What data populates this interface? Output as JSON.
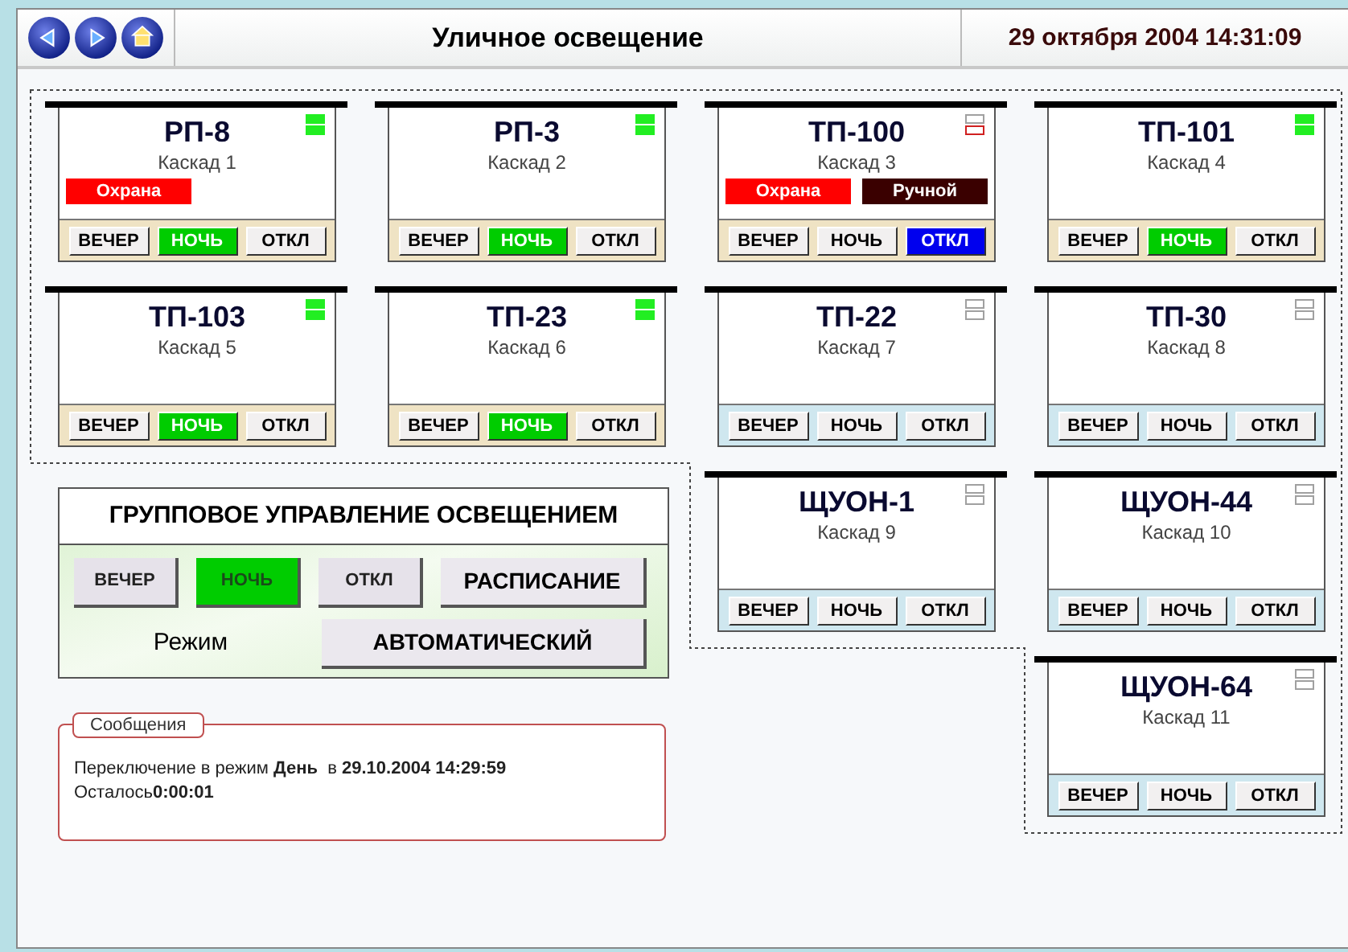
{
  "header": {
    "nav": [
      {
        "kind": "back"
      },
      {
        "kind": "forward"
      },
      {
        "kind": "home"
      }
    ],
    "title": "Уличное освещение",
    "datetime": "29 октября 2004 14:31:09"
  },
  "cards": [
    {
      "name": "РП-8",
      "subtitle": "Каскад 1",
      "lit": true,
      "fault": false,
      "connected": true,
      "tags": [
        {
          "text": "Охрана",
          "kind": "guard"
        }
      ],
      "buttons": [
        {
          "label": "ВЕЧЕР",
          "selected": false
        },
        {
          "label": "НОЧЬ",
          "selected": true
        },
        {
          "label": "ОТКЛ",
          "selected": false
        }
      ]
    },
    {
      "name": "РП-3",
      "subtitle": "Каскад 2",
      "lit": true,
      "fault": false,
      "connected": true,
      "buttons": [
        {
          "label": "ВЕЧЕР",
          "selected": false
        },
        {
          "label": "НОЧЬ",
          "selected": true
        },
        {
          "label": "ОТКЛ",
          "selected": false
        }
      ]
    },
    {
      "name": "ТП-100",
      "subtitle": "Каскад 3",
      "lit": false,
      "fault": true,
      "connected": true,
      "tags": [
        {
          "text": "Охрана",
          "kind": "guard"
        },
        {
          "text": "Ручной",
          "kind": "manual"
        }
      ],
      "buttons": [
        {
          "label": "ВЕЧЕР",
          "selected": false
        },
        {
          "label": "НОЧЬ",
          "selected": false
        },
        {
          "label": "ОТКЛ",
          "selected": true
        }
      ]
    },
    {
      "name": "ТП-101",
      "subtitle": "Каскад 4",
      "lit": true,
      "fault": false,
      "connected": true,
      "buttons": [
        {
          "label": "ВЕЧЕР",
          "selected": false
        },
        {
          "label": "НОЧЬ",
          "selected": true
        },
        {
          "label": "ОТКЛ",
          "selected": false
        }
      ]
    },
    {
      "name": "ТП-103",
      "subtitle": "Каскад 5",
      "lit": true,
      "fault": false,
      "connected": true,
      "buttons": [
        {
          "label": "ВЕЧЕР",
          "selected": false
        },
        {
          "label": "НОЧЬ",
          "selected": true
        },
        {
          "label": "ОТКЛ",
          "selected": false
        }
      ]
    },
    {
      "name": "ТП-23",
      "subtitle": "Каскад 6",
      "lit": true,
      "fault": false,
      "connected": true,
      "buttons": [
        {
          "label": "ВЕЧЕР",
          "selected": false
        },
        {
          "label": "НОЧЬ",
          "selected": true
        },
        {
          "label": "ОТКЛ",
          "selected": false
        }
      ]
    },
    {
      "name": "ТП-22",
      "subtitle": "Каскад 7",
      "lit": false,
      "fault": false,
      "connected": false,
      "buttons": [
        {
          "label": "ВЕЧЕР",
          "selected": false
        },
        {
          "label": "НОЧЬ",
          "selected": false
        },
        {
          "label": "ОТКЛ",
          "selected": false
        }
      ]
    },
    {
      "name": "ТП-30",
      "subtitle": "Каскад 8",
      "lit": false,
      "fault": false,
      "connected": false,
      "buttons": [
        {
          "label": "ВЕЧЕР",
          "selected": false
        },
        {
          "label": "НОЧЬ",
          "selected": false
        },
        {
          "label": "ОТКЛ",
          "selected": false
        }
      ]
    },
    {
      "name": "ЩУОН-1",
      "subtitle": "Каскад 9",
      "lit": false,
      "fault": false,
      "connected": false,
      "buttons": [
        {
          "label": "ВЕЧЕР",
          "selected": false
        },
        {
          "label": "НОЧЬ",
          "selected": false
        },
        {
          "label": "ОТКЛ",
          "selected": false
        }
      ]
    },
    {
      "name": "ЩУОН-44",
      "subtitle": "Каскад 10",
      "lit": false,
      "fault": false,
      "connected": false,
      "buttons": [
        {
          "label": "ВЕЧЕР",
          "selected": false
        },
        {
          "label": "НОЧЬ",
          "selected": false
        },
        {
          "label": "ОТКЛ",
          "selected": false
        }
      ]
    },
    {
      "name": "ЩУОН-64",
      "subtitle": "Каскад 11",
      "lit": false,
      "fault": false,
      "connected": false,
      "buttons": [
        {
          "label": "ВЕЧЕР",
          "selected": false
        },
        {
          "label": "НОЧЬ",
          "selected": false
        },
        {
          "label": "ОТКЛ",
          "selected": false
        }
      ]
    }
  ],
  "group_control": {
    "title": "ГРУППОВОЕ УПРАВЛЕНИЕ ОСВЕЩЕНИЕМ",
    "buttons": [
      {
        "label": "ВЕЧЕР",
        "selected": false
      },
      {
        "label": "НОЧЬ",
        "selected": true
      },
      {
        "label": "ОТКЛ",
        "selected": false
      }
    ],
    "schedule_button": "РАСПИСАНИЕ",
    "mode_label": "Режим",
    "mode_button": "АВТОМАТИЧЕСКИЙ"
  },
  "messages": {
    "legend": "Сообщения",
    "lines": [
      "Переключение в режим **День**  в **29.10.2004 14:29:59**",
      "Осталось**0:00:01**"
    ]
  }
}
